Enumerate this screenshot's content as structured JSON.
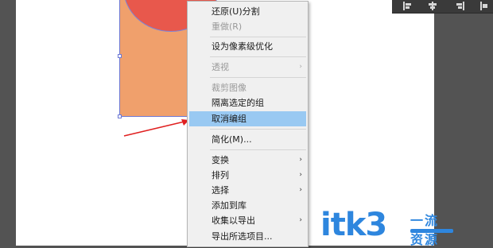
{
  "colors": {
    "artboard_bg": "#ffffff",
    "workspace_bg": "#535353",
    "orange_shape": "#f0a06c",
    "red_shape": "#e8584c",
    "selection": "#6d78d4",
    "menu_bg": "#f0f0f0",
    "menu_highlight": "#99c9f2",
    "arrow_annotation": "#e02020",
    "watermark": "#2e86de"
  },
  "toolbar_icons": [
    "align-left-icon",
    "align-center-icon",
    "align-right-icon",
    "distribute-icon"
  ],
  "context_menu": {
    "items": [
      {
        "id": "undo",
        "label": "还原(U)分割",
        "disabled": false,
        "submenu": false
      },
      {
        "id": "redo",
        "label": "重做(R)",
        "disabled": true,
        "submenu": false
      },
      {
        "id": "pixel-optimize",
        "label": "设为像素级优化",
        "disabled": false,
        "submenu": false
      },
      {
        "id": "perspective",
        "label": "透视",
        "disabled": true,
        "submenu": true
      },
      {
        "id": "crop-image",
        "label": "裁剪图像",
        "disabled": true,
        "submenu": false
      },
      {
        "id": "isolate-group",
        "label": "隔离选定的组",
        "disabled": false,
        "submenu": false
      },
      {
        "id": "ungroup",
        "label": "取消编组",
        "disabled": false,
        "submenu": false,
        "highlighted": true
      },
      {
        "id": "simplify",
        "label": "简化(M)...",
        "disabled": false,
        "submenu": false
      },
      {
        "id": "transform",
        "label": "变换",
        "disabled": false,
        "submenu": true
      },
      {
        "id": "arrange",
        "label": "排列",
        "disabled": false,
        "submenu": true
      },
      {
        "id": "select",
        "label": "选择",
        "disabled": false,
        "submenu": true
      },
      {
        "id": "add-to-library",
        "label": "添加到库",
        "disabled": false,
        "submenu": false
      },
      {
        "id": "collect-export",
        "label": "收集以导出",
        "disabled": false,
        "submenu": true
      },
      {
        "id": "export-selection",
        "label": "导出所选项目...",
        "disabled": false,
        "submenu": false
      }
    ],
    "submenu_arrow": "›"
  },
  "watermark": {
    "text": "itk3",
    "subtext": "一流资源"
  }
}
